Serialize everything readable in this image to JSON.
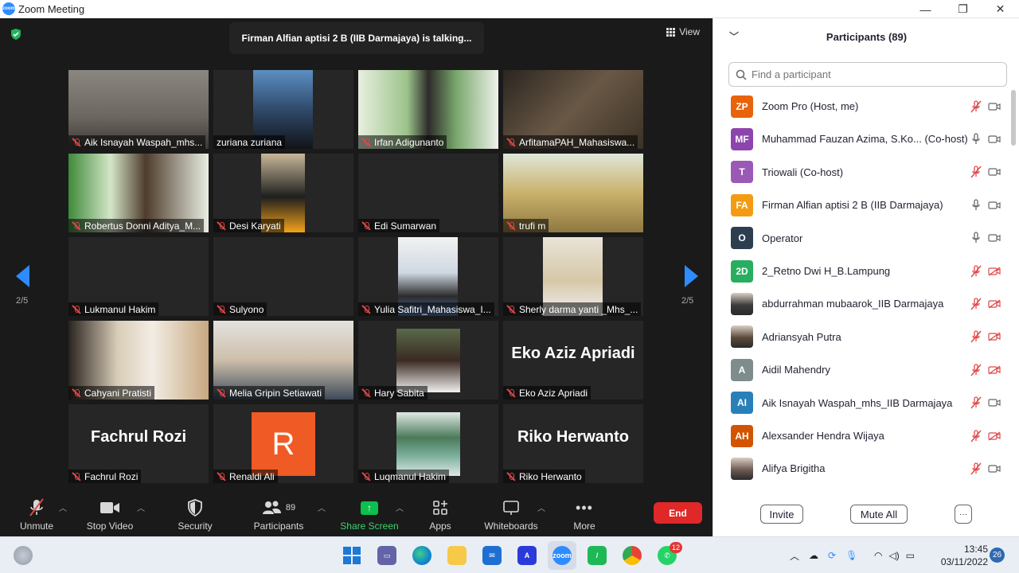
{
  "window": {
    "title": "Zoom Meeting",
    "logo_text": "zoom"
  },
  "meeting": {
    "talking": "Firman Alfian aptisi 2 B (IIB Darmajaya) is talking...",
    "view_label": "View",
    "page_left": "2/5",
    "page_right": "2/5"
  },
  "tiles": [
    {
      "name": "Aik Isnayah Waspah_mhs..."
    },
    {
      "name": "zuriana zuriana"
    },
    {
      "name": "Irfan Adigunanto"
    },
    {
      "name": "ArfitamaPAH_Mahasiswa..."
    },
    {
      "name": "Robertus Donni Aditya_M..."
    },
    {
      "name": "Desi Karyati"
    },
    {
      "name": "Edi Sumarwan"
    },
    {
      "name": "trufi m"
    },
    {
      "name": "Lukmanul Hakim"
    },
    {
      "name": "Sulyono"
    },
    {
      "name": "Yulia Safitri_Mahasiswa_I..."
    },
    {
      "name": "Sherly darma yanti _Mhs_..."
    },
    {
      "name": "Cahyani Pratisti"
    },
    {
      "name": "Melia Gripin Setiawati"
    },
    {
      "name": "Hary Sabita"
    },
    {
      "name": "Eko Aziz Apriadi",
      "big": "Eko Aziz Apriadi"
    },
    {
      "name": "Fachrul Rozi",
      "big": "Fachrul Rozi"
    },
    {
      "name": "Renaldi Ali",
      "initial": "R"
    },
    {
      "name": "Luqmanul Hakim"
    },
    {
      "name": "Riko Herwanto",
      "big": "Riko Herwanto"
    }
  ],
  "toolbar": {
    "unmute": "Unmute",
    "stop_video": "Stop Video",
    "security": "Security",
    "participants": "Participants",
    "participants_count": "89",
    "share_screen": "Share Screen",
    "apps": "Apps",
    "whiteboards": "Whiteboards",
    "more": "More",
    "end": "End"
  },
  "panel": {
    "title": "Participants (89)",
    "search_placeholder": "Find a participant",
    "invite": "Invite",
    "mute_all": "Mute All",
    "more": "···"
  },
  "participants": [
    {
      "initials": "ZP",
      "color": "#E8630A",
      "name": "Zoom Pro (Host, me)",
      "mic": "muted",
      "cam": "on"
    },
    {
      "initials": "MF",
      "color": "#8E44AD",
      "name": "Muhammad Fauzan Azima, S.Ko...  (Co-host)",
      "mic": "on",
      "cam": "on"
    },
    {
      "initials": "T",
      "color": "#9B59B6",
      "name": "Triowali (Co-host)",
      "mic": "muted",
      "cam": "on"
    },
    {
      "initials": "FA",
      "color": "#F39C12",
      "name": "Firman Alfian aptisi 2 B (IIB Darmajaya)",
      "mic": "on",
      "cam": "on"
    },
    {
      "initials": "O",
      "color": "#2C3E50",
      "name": "Operator",
      "mic": "on",
      "cam": "on"
    },
    {
      "initials": "2D",
      "color": "#27AE60",
      "name": "2_Retno Dwi H_B.Lampung",
      "mic": "muted",
      "cam": "off"
    },
    {
      "initials": "",
      "color": "#3b3b3b",
      "name": "abdurrahman mubaarok_IIB Darmajaya",
      "mic": "muted",
      "cam": "off",
      "photo": true
    },
    {
      "initials": "",
      "color": "#5a4a3a",
      "name": "Adriansyah Putra",
      "mic": "muted",
      "cam": "off",
      "photo": true
    },
    {
      "initials": "A",
      "color": "#7F8C8D",
      "name": "Aidil Mahendry",
      "mic": "muted",
      "cam": "off"
    },
    {
      "initials": "AI",
      "color": "#2980B9",
      "name": "Aik Isnayah Waspah_mhs_IIB Darmajaya",
      "mic": "muted",
      "cam": "on"
    },
    {
      "initials": "AH",
      "color": "#D35400",
      "name": "Alexsander Hendra Wijaya",
      "mic": "muted",
      "cam": "off"
    },
    {
      "initials": "",
      "color": "#6e5a52",
      "name": "Alifya Brigitha",
      "mic": "muted",
      "cam": "on",
      "photo": true
    }
  ],
  "taskbar": {
    "time": "13:45",
    "date": "03/11/2022",
    "notification_count": "26",
    "whatsapp_badge": "12"
  },
  "colors": {
    "accent": "#2D8CFF",
    "end": "#E02828",
    "share": "#0CBF4E",
    "muted": "#E04646"
  }
}
